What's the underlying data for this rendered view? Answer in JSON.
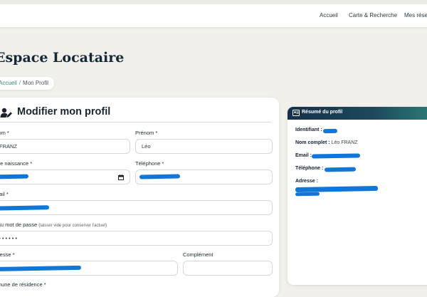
{
  "nav": {
    "items": [
      {
        "label": "Accueil"
      },
      {
        "label": "Carte & Recherche"
      },
      {
        "label": "Mes réservations"
      }
    ]
  },
  "page": {
    "title": "Espace Locataire",
    "breadcrumb": {
      "home": "Accueil",
      "separator": "/",
      "current": "Mon Profil"
    }
  },
  "form": {
    "title": "Modifier mon profil",
    "fields": {
      "nom": {
        "label": "Nom *",
        "value": "FRANZ"
      },
      "prenom": {
        "label": "Prénom *",
        "value": "Léo"
      },
      "date_naissance": {
        "label": "Date de naissance *"
      },
      "telephone": {
        "label": "Téléphone *"
      },
      "email": {
        "label": "Email *"
      },
      "password": {
        "label": "Nouveau mot de passe",
        "hint": "(laisser vide pour conserver l'actuel)",
        "value": "••••••••"
      },
      "adresse": {
        "label": "Adresse *"
      },
      "complement": {
        "label": "Complément"
      }
    },
    "next_label": "Commune de résidence *"
  },
  "summary": {
    "title": "Résumé du profil",
    "identifiant_label": "Identifiant :",
    "nom_complet_label": "Nom complet :",
    "nom_complet_value": "Léo FRANZ",
    "email_label": "Email :",
    "telephone_label": "Téléphone :",
    "adresse_label": "Adresse :"
  },
  "colors": {
    "accent": "#2f8a7a",
    "header_dark": "#14304a",
    "redaction": "#1276d8",
    "title": "#14283a"
  },
  "icons": {
    "form_title": "user-edit-icon",
    "summary_title": "user-card-icon",
    "date_picker": "calendar-icon"
  }
}
